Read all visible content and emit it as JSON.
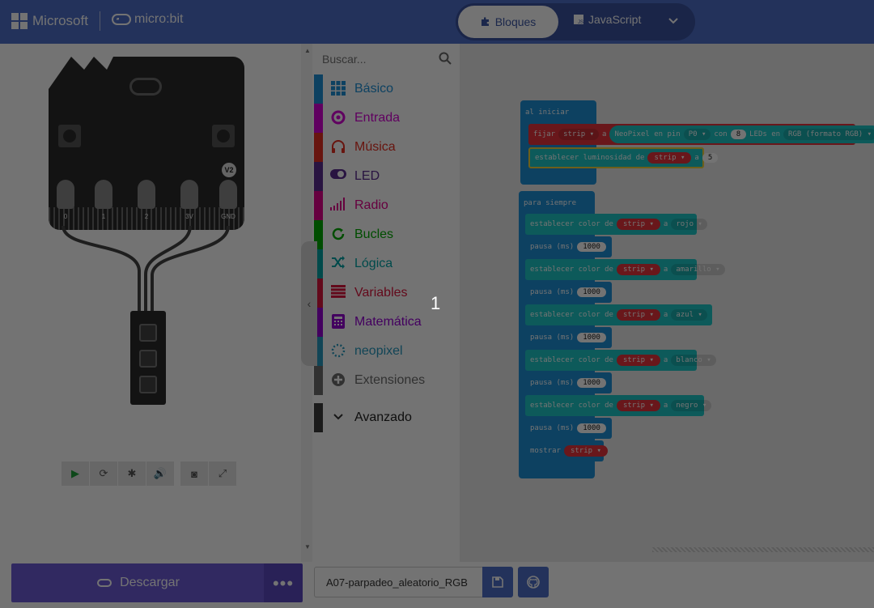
{
  "header": {
    "brand": "Microsoft",
    "product": "micro:bit",
    "modes": {
      "blocks": "Bloques",
      "javascript": "JavaScript"
    },
    "accent": "#4e6fc9"
  },
  "simulator": {
    "board_badge": "V2",
    "pins": [
      "0",
      "1",
      "2",
      "3V",
      "GND"
    ],
    "toolbar": [
      "play-icon",
      "restart-icon",
      "debug-icon",
      "sound-icon",
      "screenshot-icon",
      "fullscreen-icon"
    ]
  },
  "toolbox": {
    "search": {
      "placeholder": "Buscar..."
    },
    "categories": [
      {
        "label": "Básico",
        "color": "#1e90d8",
        "icon": "grid-icon"
      },
      {
        "label": "Entrada",
        "color": "#d400d4",
        "icon": "input-icon"
      },
      {
        "label": "Música",
        "color": "#e63022",
        "icon": "headphones-icon"
      },
      {
        "label": "LED",
        "color": "#5c2d91",
        "icon": "toggle-icon"
      },
      {
        "label": "Radio",
        "color": "#e3008c",
        "icon": "signal-icon"
      },
      {
        "label": "Bucles",
        "color": "#00aa00",
        "icon": "loop-icon"
      },
      {
        "label": "Lógica",
        "color": "#00a4a6",
        "icon": "shuffle-icon"
      },
      {
        "label": "Variables",
        "color": "#dc143c",
        "icon": "variables-icon"
      },
      {
        "label": "Matemática",
        "color": "#9400d3",
        "icon": "calculator-icon"
      },
      {
        "label": "neopixel",
        "color": "#2699bf",
        "icon": "dotted-circle-icon"
      },
      {
        "label": "Extensiones",
        "color": "#6d6d6d",
        "icon": "plus-circle-icon"
      }
    ],
    "advanced": {
      "label": "Avanzado",
      "color": "#3c3c3c"
    }
  },
  "workspace": {
    "step_number": "1",
    "on_start": {
      "label": "al iniciar",
      "set_var": {
        "keyword": "fijar",
        "var": "strip",
        "to": "a",
        "call": "NeoPixel en pin",
        "pin": "P0",
        "with": "con",
        "leds": "8",
        "leds_label": "LEDs en",
        "mode": "RGB (formato RGB)"
      },
      "brightness": {
        "label": "establecer luminosidad de",
        "var": "strip",
        "to": "a",
        "value": "5"
      }
    },
    "forever": {
      "label": "para siempre",
      "steps": [
        {
          "set": "establecer color de",
          "var": "strip",
          "to": "a",
          "color": "rojo",
          "pause": "pausa (ms)",
          "ms": "1000"
        },
        {
          "set": "establecer color de",
          "var": "strip",
          "to": "a",
          "color": "amarillo",
          "pause": "pausa (ms)",
          "ms": "1000"
        },
        {
          "set": "establecer color de",
          "var": "strip",
          "to": "a",
          "color": "azul",
          "pause": "pausa (ms)",
          "ms": "1000"
        },
        {
          "set": "establecer color de",
          "var": "strip",
          "to": "a",
          "color": "blanco",
          "pause": "pausa (ms)",
          "ms": "1000"
        },
        {
          "set": "establecer color de",
          "var": "strip",
          "to": "a",
          "color": "negro",
          "pause": "pausa (ms)",
          "ms": "1000"
        }
      ],
      "show": {
        "label": "mostrar",
        "var": "strip"
      }
    }
  },
  "bottombar": {
    "download_label": "Descargar",
    "more_label": "•••",
    "project_name": "A07-parpadeo_aleatorio_RGB"
  }
}
